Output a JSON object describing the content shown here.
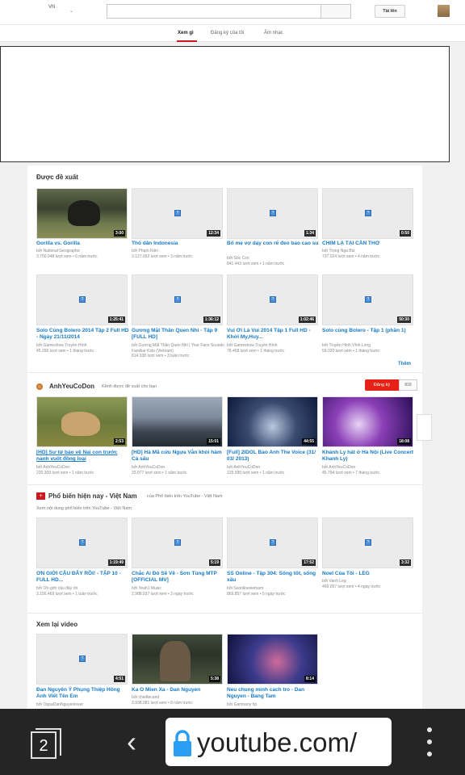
{
  "header": {
    "region": "VN",
    "upload_label": "Tải lên"
  },
  "tabs": [
    {
      "label": "Xem gì",
      "active": true
    },
    {
      "label": "Đăng ký của tôi"
    },
    {
      "label": "Âm nhạc"
    }
  ],
  "recommended": {
    "title": "Được đề xuất",
    "more_label": "Thêm",
    "videos": [
      {
        "title": "Gorilla vs. Gorilla",
        "by": "bởi National Geographic",
        "views": "3.756.048 lượt xem",
        "age": "6 năm trước",
        "duration": "3:00"
      },
      {
        "title": "Thổ dân Indonesia",
        "by": "bởi Phạm Kiên",
        "views": "3.127.002 lượt xem",
        "age": "3 năm trước",
        "duration": "12:34"
      },
      {
        "title": "Bố mẹ vợ dạy con rể đeo bao cao su",
        "by": "bởi Sốc Con",
        "views": "841.443 lượt xem",
        "age": "1 năm trước",
        "duration": "1:34"
      },
      {
        "title": "CHIM LẠ TẠI CẦN THƠ",
        "by": "bởi Trọng Nga Bùi",
        "views": "737.024 lượt xem",
        "age": "4 năm trước",
        "duration": "0:50"
      },
      {
        "title": "Solo Cùng Bolero 2014 Tập 2 Full HD - Ngày 21/11/2014",
        "by": "bởi Gameshow Truyền Hình",
        "views": "45.290 lượt xem",
        "age": "1 tháng trước",
        "duration": "1:25:41"
      },
      {
        "title": "Gương Mặt Thân Quen Nhí - Tập 9 [FULL HD]",
        "by": "bởi Gương Mặt Thân Quen Nhí | Your Face Sounds Familiar Kids (Vietnam)",
        "views": "814.338 lượt xem",
        "age": "3 tuần trước",
        "duration": "1:36:12"
      },
      {
        "title": "Vui Ơi Là Vui 2014 Tập 1 Full HD - Khởi My,Huy...",
        "by": "bởi Gameshow Truyền Hình",
        "views": "78.468 lượt xem",
        "age": "1 tháng trước",
        "duration": "1:02:46"
      },
      {
        "title": "Solo cùng Bolero - Tập 1 (phần 1)",
        "by": "bởi Truyền Hình Vĩnh Long",
        "views": "59.020 lượt xem",
        "age": "1 tháng trước",
        "duration": "50:30"
      }
    ]
  },
  "channel": {
    "name": "AnhYeuCoDon",
    "note": "Kênh được đề xuất cho bạn",
    "subscribe_label": "Đăng ký",
    "subscriber_count": "818",
    "videos": [
      {
        "title": "[HD] Sư tử bảo vệ Nai con trước nanh vuốt đồng loại",
        "by": "bởi AnhYeuCoDon",
        "views": "220.309 lượt xem",
        "age": "1 năm trước",
        "duration": "2:53"
      },
      {
        "title": "[HD] Hà Mã cứu Ngựa Vằn khỏi hàm Cá sấu",
        "by": "bởi AnhYeuCoDon",
        "views": "33.077 lượt xem",
        "age": "1 năm trước",
        "duration": "15:01"
      },
      {
        "title": "[Full] 2IDOL Bảo Anh The Voice (31/ 03/ 2013)",
        "by": "bởi AnhYeuCoDon",
        "views": "129.990 lượt xem",
        "age": "1 năm trước",
        "duration": "44:55"
      },
      {
        "title": "Khánh Ly hát ở Hà Nội (Live Concert Khanh Ly)",
        "by": "bởi AnhYeuCoDon",
        "views": "45.794 lượt xem",
        "age": "7 tháng trước",
        "duration": "18:08"
      }
    ]
  },
  "popular": {
    "title": "Phổ biến hiện nay - Việt Nam",
    "source": "của Phổ biến trên YouTube - Việt Nam",
    "subtitle": "Xem nội dung phổ biến trên YouTube - Việt Nam",
    "videos": [
      {
        "title": "ƠN GIỜI CẬU ĐÂY RỒI! - TẬP 10 - FULL HD...",
        "by": "bởi Ơn giời cậu đây rồi",
        "views": "3.156.469 lượt xem",
        "age": "1 tuần trước",
        "duration": "1:19:49"
      },
      {
        "title": "Chắc Ai Đó Sẽ Về - Sơn Tùng MTP [OFFICIAL MV]",
        "by": "bởi Yeah1 Music",
        "views": "2.988.937 lượt xem",
        "age": "3 ngày trước",
        "duration": "5:19"
      },
      {
        "title": "SS Online - Tập 304: Sống tốt, sống xấu",
        "by": "bởi Ssonlinevietnam",
        "views": "869.857 lượt xem",
        "age": "5 ngày trước",
        "duration": "17:52"
      },
      {
        "title": "Noel Của Tôi - LEG",
        "by": "bởi Vanh Leg",
        "views": "469.057 lượt xem",
        "age": "4 ngày trước",
        "duration": "3:32"
      }
    ]
  },
  "rewatch": {
    "title": "Xem lại video",
    "videos": [
      {
        "title": "Đan Nguyên Ý Phụng Thiệp Hồng Anh Viết Tên Em",
        "by": "bởi OppaDanNguyenlover",
        "duration": "4:51"
      },
      {
        "title": "Ka O Mien Xa - Dan Nguyen",
        "by": "bởi chieftecand",
        "views": "3.938.081 lượt xem",
        "age": "8 năm trước",
        "duration": "5:38"
      },
      {
        "title": "Neu chung minh cach tro - Dan Nguyen - Bang Tam",
        "by": "bởi Gamnany hp",
        "duration": "8:14"
      }
    ]
  },
  "browser": {
    "tab_count": "2",
    "url": "youtube.com/"
  }
}
